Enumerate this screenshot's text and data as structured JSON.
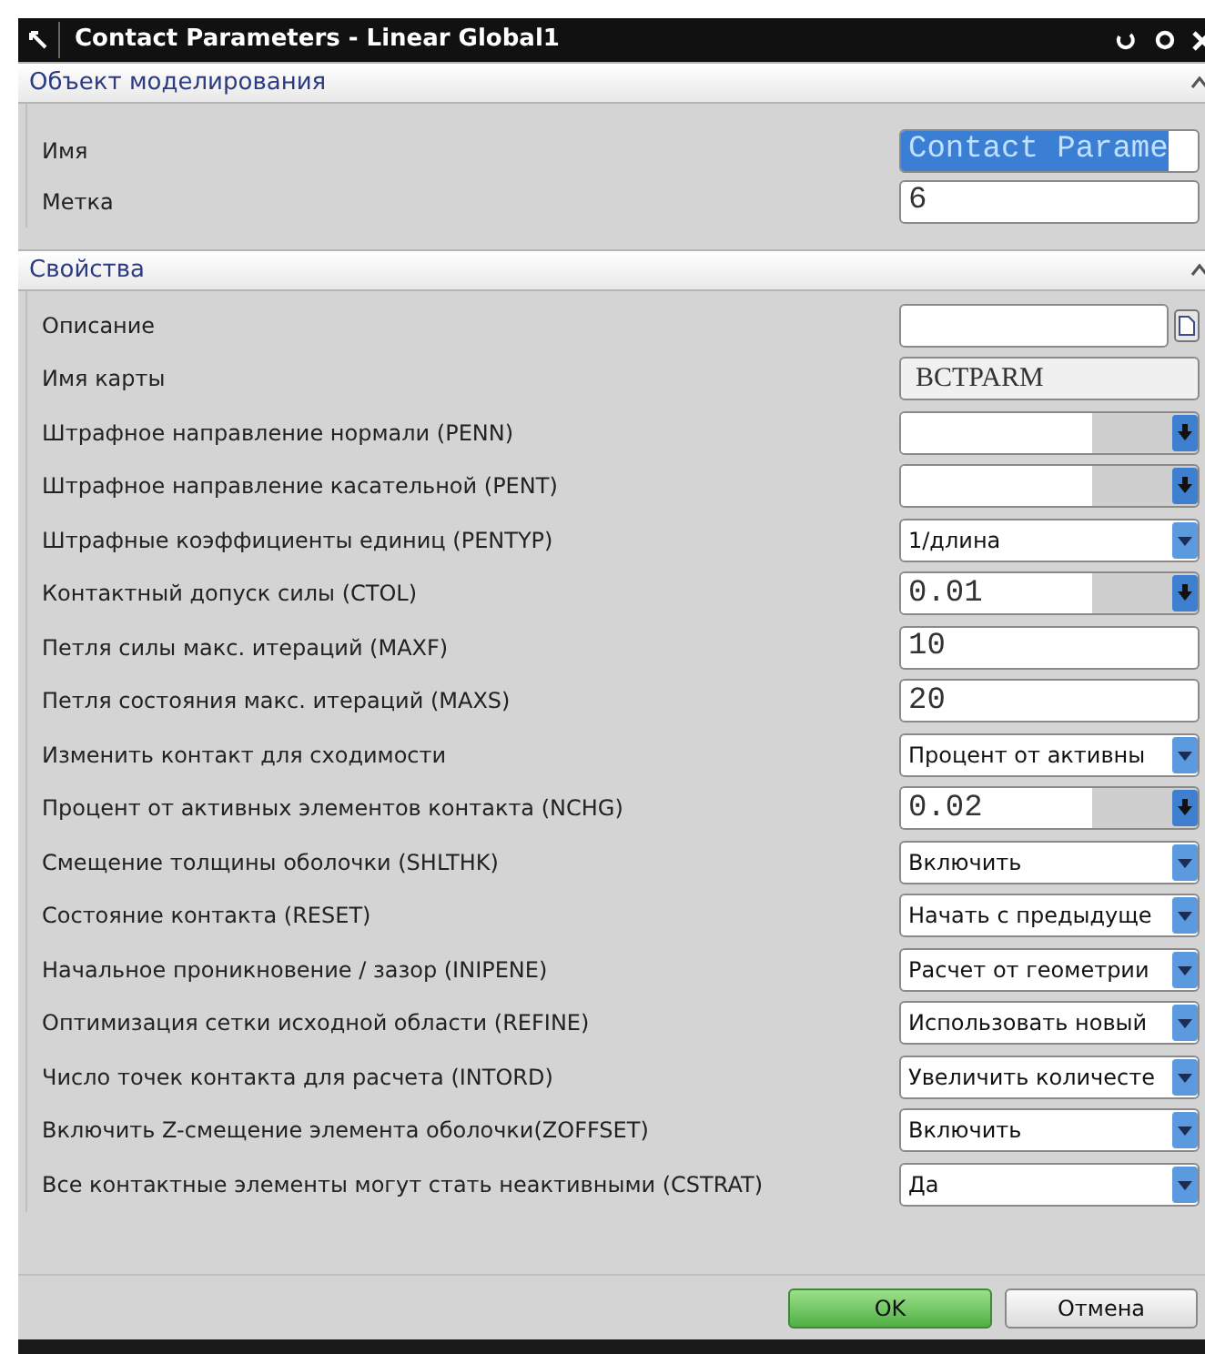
{
  "window": {
    "title": "Contact Parameters - Linear Global1"
  },
  "sections": [
    {
      "title": "Объект моделирования",
      "expanded": true,
      "rows": [
        {
          "label": "Имя",
          "kind": "input",
          "value": "Contact Parame",
          "text_selected": true
        },
        {
          "label": "Метка",
          "kind": "input",
          "value": "6",
          "text_selected": false
        }
      ]
    },
    {
      "title": "Свойства",
      "expanded": true,
      "rows": [
        {
          "label": "Описание",
          "kind": "file",
          "value": ""
        },
        {
          "label": "Имя карты",
          "kind": "readonly",
          "value": "BCTPARM"
        },
        {
          "label": "Штрафное направление нормали (PENN)",
          "kind": "unit",
          "value": ""
        },
        {
          "label": "Штрафное направление касательной (PENT)",
          "kind": "unit",
          "value": ""
        },
        {
          "label": "Штрафные коэффициенты единиц (PENTYP)",
          "kind": "select",
          "value": "1/длина"
        },
        {
          "label": "Контактный допуск силы (CTOL)",
          "kind": "unit",
          "value": "0.01"
        },
        {
          "label": "Петля силы макс. итераций (MAXF)",
          "kind": "input",
          "value": "10",
          "text_selected": false
        },
        {
          "label": "Петля состояния макс. итераций (MAXS)",
          "kind": "input",
          "value": "20",
          "text_selected": false
        },
        {
          "label": "Изменить контакт для сходимости",
          "kind": "select",
          "value": "Процент от активны"
        },
        {
          "label": "Процент от активных элементов контакта (NCHG)",
          "kind": "unit",
          "value": "0.02"
        },
        {
          "label": "Смещение толщины оболочки (SHLTHK)",
          "kind": "select",
          "value": "Включить"
        },
        {
          "label": "Состояние контакта (RESET)",
          "kind": "select",
          "value": "Начать с предыдуще"
        },
        {
          "label": "Начальное проникновение / зазор (INIPENE)",
          "kind": "select",
          "value": "Расчет от геометрии"
        },
        {
          "label": "Оптимизация сетки исходной области (REFINE)",
          "kind": "select",
          "value": "Использовать новый"
        },
        {
          "label": "Число точек контакта для расчета (INTORD)",
          "kind": "select",
          "value": "Увеличить количесте"
        },
        {
          "label": "Включить Z-смещение элемента оболочки(ZOFFSET)",
          "kind": "select",
          "value": "Включить"
        },
        {
          "label": "Все контактные элементы могут стать неактивными (CSTRAT)",
          "kind": "select",
          "value": "Да"
        }
      ]
    }
  ],
  "buttons": [
    {
      "label": "OK",
      "kind": "primary"
    },
    {
      "label": "Отмена",
      "kind": "secondary"
    }
  ]
}
